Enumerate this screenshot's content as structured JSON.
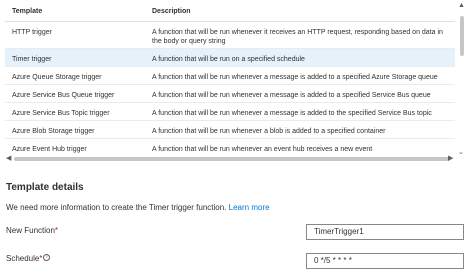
{
  "templates": {
    "headers": {
      "template": "Template",
      "description": "Description"
    },
    "rows": [
      {
        "name": "HTTP trigger",
        "description": "A function that will be run whenever it receives an HTTP request, responding based on data in the body or query string"
      },
      {
        "name": "Timer trigger",
        "description": "A function that will be run on a specified schedule",
        "selected": true
      },
      {
        "name": "Azure Queue Storage trigger",
        "description": "A function that will be run whenever a message is added to a specified Azure Storage queue"
      },
      {
        "name": "Azure Service Bus Queue trigger",
        "description": "A function that will be run whenever a message is added to a specified Service Bus queue"
      },
      {
        "name": "Azure Service Bus Topic trigger",
        "description": "A function that will be run whenever a message is added to the specified Service Bus topic"
      },
      {
        "name": "Azure Blob Storage trigger",
        "description": "A function that will be run whenever a blob is added to a specified container"
      },
      {
        "name": "Azure Event Hub trigger",
        "description": "A function that will be run whenever an event hub receives a new event"
      }
    ]
  },
  "details": {
    "title": "Template details",
    "info_text": "We need more information to create the Timer trigger function.",
    "learn_more": "Learn more",
    "new_function_label": "New Function",
    "new_function_value": "TimerTrigger1",
    "schedule_label": "Schedule",
    "schedule_value": "0 */5 * * * *",
    "required_mark": "*",
    "info_glyph": "i"
  },
  "colors": {
    "accent": "#0078d4",
    "selected_row": "#e5f1fb",
    "required": "#a4262c"
  },
  "icons": {
    "scroll_left": "chevron-left-icon",
    "scroll_right": "chevron-right-icon",
    "scroll_up": "chevron-up-icon",
    "scroll_down": "chevron-down-icon",
    "info": "info-icon"
  }
}
